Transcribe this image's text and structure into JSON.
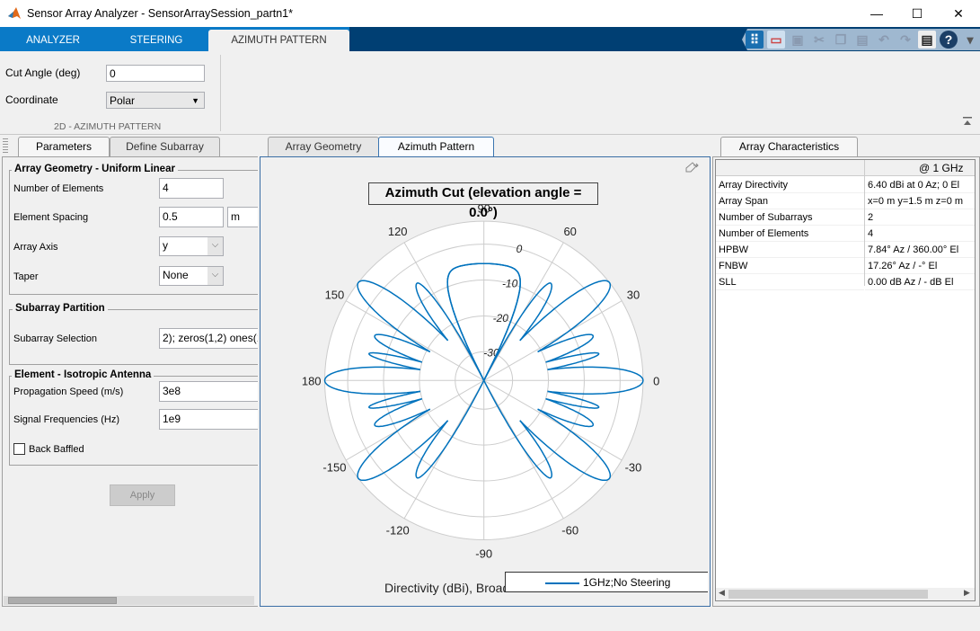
{
  "window": {
    "title": "Sensor Array Analyzer - SensorArraySession_partn1*",
    "minimize": "—",
    "maximize": "☐",
    "close": "✕"
  },
  "main_tabs": [
    {
      "label": "ANALYZER"
    },
    {
      "label": "STEERING"
    },
    {
      "label": "AZIMUTH PATTERN",
      "active": true
    }
  ],
  "toolbar_icons": [
    "plot-pattern-icon",
    "report-icon",
    "save-icon",
    "cut-icon",
    "copy-icon",
    "paste-icon",
    "undo-icon",
    "redo-icon",
    "layout-icon",
    "help-icon",
    "expand-menu-icon"
  ],
  "toolstrip": {
    "cut_angle_label": "Cut Angle (deg)",
    "cut_angle_value": "0",
    "coordinate_label": "Coordinate",
    "coordinate_value": "Polar",
    "section_label": "2D - AZIMUTH PATTERN"
  },
  "left_panel": {
    "tabs": [
      {
        "label": "Parameters",
        "active": true
      },
      {
        "label": "Define Subarray"
      }
    ],
    "array_geometry": {
      "title": "Array Geometry - Uniform Linear",
      "num_elements_label": "Number of Elements",
      "num_elements": "4",
      "spacing_label": "Element Spacing",
      "spacing": "0.5",
      "spacing_unit": "m",
      "axis_label": "Array Axis",
      "axis": "y",
      "taper_label": "Taper",
      "taper": "None"
    },
    "subarray": {
      "title": "Subarray Partition",
      "selection_label": "Subarray Selection",
      "selection": "2); zeros(1,2) ones(1"
    },
    "element": {
      "title": "Element - Isotropic Antenna",
      "speed_label": "Propagation Speed (m/s)",
      "speed": "3e8",
      "freq_label": "Signal Frequencies (Hz)",
      "freq": "1e9",
      "back_baffled_label": "Back Baffled",
      "back_baffled": false
    },
    "apply_label": "Apply"
  },
  "center_panel": {
    "tabs": [
      {
        "label": "Array Geometry"
      },
      {
        "label": "Azimuth Pattern",
        "active": true
      }
    ]
  },
  "chart_data": {
    "type": "polar",
    "title": "Azimuth Cut (elevation angle = 0.0°)",
    "xlabel": "Directivity (dBi), Broadside",
    "angle_ticks": [
      "0",
      "30",
      "60",
      "90",
      "120",
      "150",
      "180",
      "-150",
      "-120",
      "-90",
      "-60",
      "-30"
    ],
    "radial_ticks": [
      "0",
      "-10",
      "-20",
      "-30"
    ],
    "rlim": [
      -38,
      6.4
    ],
    "grid": true,
    "legend_placement": "bottom-right",
    "series": [
      {
        "name": "1GHz;No Steering",
        "color": "#0072bd",
        "lobes": [
          {
            "azimuth": 0,
            "from": -9.7,
            "to": 9.7,
            "peak_dBi": 6.4,
            "edge_dBi": [
              -20,
              -20
            ]
          },
          {
            "azimuth": 12.5,
            "from": 9.7,
            "to": 16.5,
            "peak_dBi": -5.1,
            "edge_dBi": [
              -20,
              -20
            ]
          },
          {
            "azimuth": 22,
            "from": 16.5,
            "to": 28,
            "peak_dBi": -5.1,
            "edge_dBi": [
              -20,
              -21
            ]
          },
          {
            "azimuth": 37.6,
            "from": 28,
            "to": 48,
            "peak_dBi": 6.4,
            "edge_dBi": [
              -21,
              -23
            ]
          },
          {
            "azimuth": 54,
            "from": 48,
            "to": 63,
            "peak_dBi": -5.1,
            "edge_dBi": [
              -23,
              -40
            ]
          },
          {
            "azimuth": 90,
            "from": 63,
            "to": 117,
            "peak_dBi": -5.4,
            "edge_dBi": [
              -40,
              -40
            ]
          }
        ]
      }
    ]
  },
  "right_panel": {
    "tab": "Array Characteristics",
    "header": "@ 1 GHz",
    "rows": [
      [
        "Array Directivity",
        "6.40 dBi at 0 Az; 0 El"
      ],
      [
        "Array Span",
        "x=0 m y=1.5 m z=0 m"
      ],
      [
        "Number of Subarrays",
        "2"
      ],
      [
        "Number of Elements",
        "4"
      ],
      [
        "HPBW",
        "7.84° Az / 360.00° El"
      ],
      [
        "FNBW",
        "17.26° Az / -° El"
      ],
      [
        "SLL",
        "0.00 dB Az / - dB El"
      ]
    ]
  }
}
